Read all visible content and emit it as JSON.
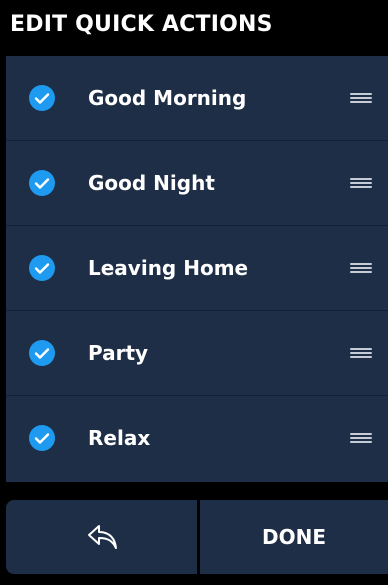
{
  "header": {
    "title": "EDIT QUICK ACTIONS"
  },
  "actions": [
    {
      "label": "Good Morning",
      "checked": true
    },
    {
      "label": "Good Night",
      "checked": true
    },
    {
      "label": "Leaving Home",
      "checked": true
    },
    {
      "label": "Party",
      "checked": true
    },
    {
      "label": "Relax",
      "checked": true
    }
  ],
  "footer": {
    "back_icon": "reply-arrow-icon",
    "done_label": "DONE"
  },
  "icons": {
    "checkbox": "check-circle-icon",
    "drag": "drag-handle-icon"
  },
  "colors": {
    "background": "#000000",
    "panel": "#1e2e46",
    "accent": "#1e9bf0",
    "text": "#ffffff",
    "handle": "#c6ccd6"
  }
}
